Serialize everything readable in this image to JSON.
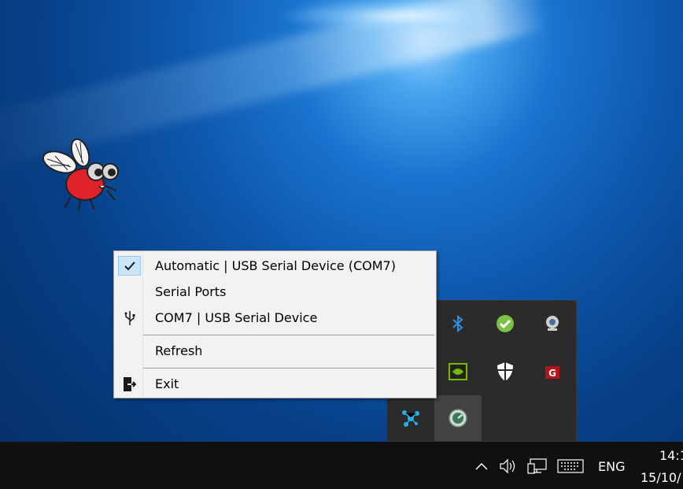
{
  "context_menu": {
    "items": [
      {
        "label": "Automatic | USB Serial Device (COM7)",
        "icon": "checkmark-icon",
        "checked": true
      },
      {
        "label": "Serial Ports",
        "icon": "",
        "checked": false
      },
      {
        "label": "COM7 | USB Serial Device",
        "icon": "usb-icon",
        "checked": false
      },
      {
        "label": "Refresh",
        "icon": "",
        "checked": false
      },
      {
        "label": "Exit",
        "icon": "exit-icon",
        "checked": false
      }
    ]
  },
  "tray_flyout": {
    "icons": [
      "bluetooth-icon",
      "green-check-app-icon",
      "webcam-icon",
      "nvidia-icon",
      "windows-defender-icon",
      "red-app-icon",
      "network-nodes-icon",
      "speed-gauge-icon"
    ]
  },
  "taskbar": {
    "language": "ENG",
    "time": "14:1",
    "date": "15/10/"
  },
  "colors": {
    "menu_bg": "#f2f2f2",
    "check_highlight": "#cce4f7",
    "taskbar": "#101010",
    "tray_bg": "#2b2b2b"
  }
}
